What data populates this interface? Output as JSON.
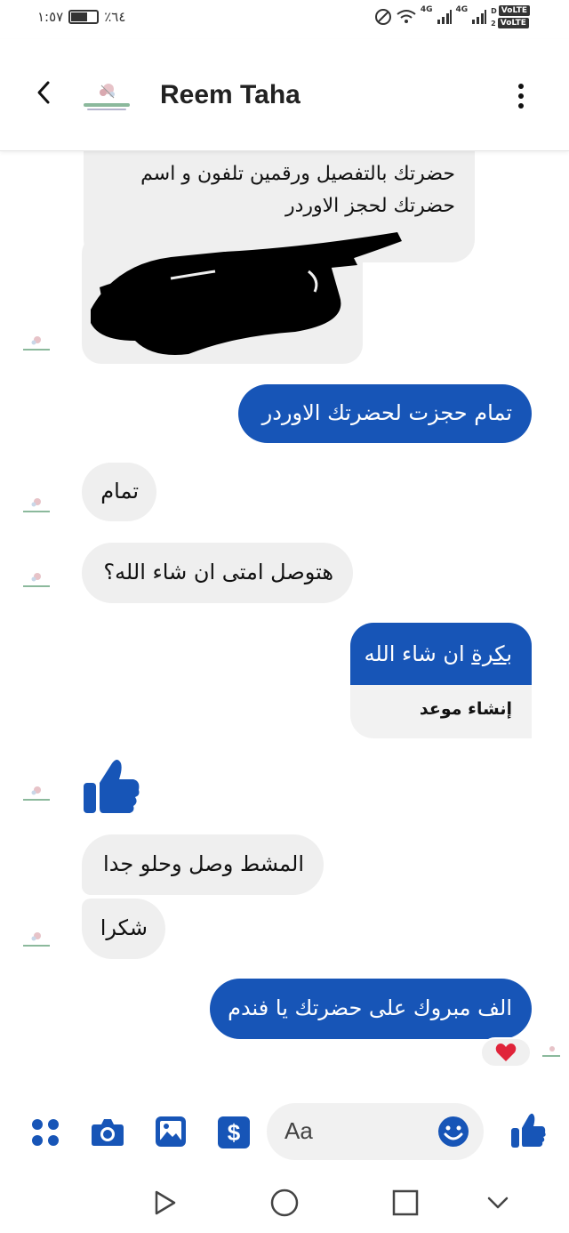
{
  "status_bar": {
    "time": "١:٥٧",
    "battery_percent": "٪٦٤",
    "battery_level": 0.64,
    "network_1": "4G",
    "network_2": "4G",
    "volte_1": "VoLTE",
    "volte_2": "VoLTE",
    "sim_1": "D",
    "sim_2": "2"
  },
  "header": {
    "contact_name": "Reem Taha",
    "back_icon": "chevron-left-icon",
    "menu_icon": "more-vertical-icon"
  },
  "messages": {
    "m1_text_line1": "حضرتك بالتفصيل ورقمين تلفون و اسم",
    "m1_text_line2": "حضرتك لحجز الاوردر",
    "m2_text": "تمام حجزت لحضرتك الاوردر",
    "m3_text": "تمام",
    "m4_text": "هتوصل امتى ان شاء الله؟",
    "m5_text_link": "بكرة",
    "m5_text_rest": " ان شاء الله",
    "m5_action": "إنشاء موعد",
    "m6_like": "thumbs-up-icon",
    "m7_text": "المشط وصل وحلو جدا",
    "m8_text": "شكرا",
    "m9_text": "الف مبروك على حضرتك يا فندم",
    "m9_reaction": "heart-icon"
  },
  "composer": {
    "placeholder": "Aa",
    "icons": [
      "apps-icon",
      "camera-icon",
      "gallery-icon",
      "payment-icon",
      "emoji-icon",
      "like-icon"
    ]
  },
  "nav": {
    "icons": [
      "back-triangle-icon",
      "home-circle-icon",
      "recents-square-icon",
      "chevron-down-icon"
    ]
  },
  "colors": {
    "brand_blue": "#1755b7",
    "incoming_bubble": "#efefef",
    "heart": "#e0243a"
  }
}
